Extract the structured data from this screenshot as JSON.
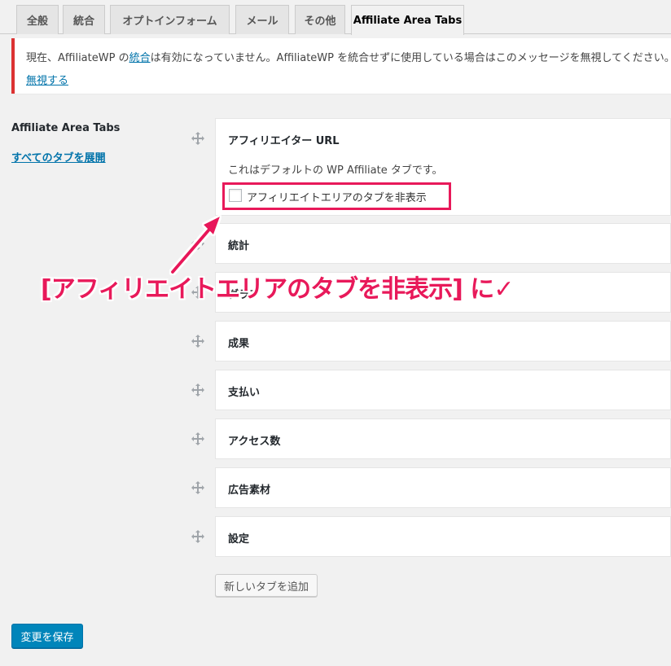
{
  "tabs": [
    {
      "label": "全般",
      "active": false
    },
    {
      "label": "統合",
      "active": false
    },
    {
      "label": "オプトインフォーム",
      "active": false
    },
    {
      "label": "メール",
      "active": false
    },
    {
      "label": "その他",
      "active": false
    },
    {
      "label": "Affiliate Area Tabs",
      "active": true
    }
  ],
  "notice": {
    "text_before": "現在、AffiliateWP の",
    "link": "統合",
    "text_after": "は有効になっていません。AffiliateWP を統合せずに使用している場合はこのメッセージを無視してください。",
    "dismiss": "無視する"
  },
  "section": {
    "label": "Affiliate Area Tabs",
    "expand_link": "すべてのタブを展開"
  },
  "panels": [
    {
      "title": "アフィリエイター URL",
      "description": "これはデフォルトの WP Affiliate タブです。",
      "checkbox_label": "アフィリエイトエリアのタブを非表示",
      "checked": false
    },
    {
      "title": "統計"
    },
    {
      "title": "グラフ"
    },
    {
      "title": "成果"
    },
    {
      "title": "支払い"
    },
    {
      "title": "アクセス数"
    },
    {
      "title": "広告素材"
    },
    {
      "title": "設定"
    }
  ],
  "callout": "[アフィリエイトエリアのタブを非表示] に✓",
  "buttons": {
    "add_tab": "新しいタブを追加",
    "save": "変更を保存"
  },
  "colors": {
    "accent": "#e8195a",
    "link": "#0073aa",
    "primary_button": "#0085ba",
    "notice_border": "#dc3232"
  }
}
